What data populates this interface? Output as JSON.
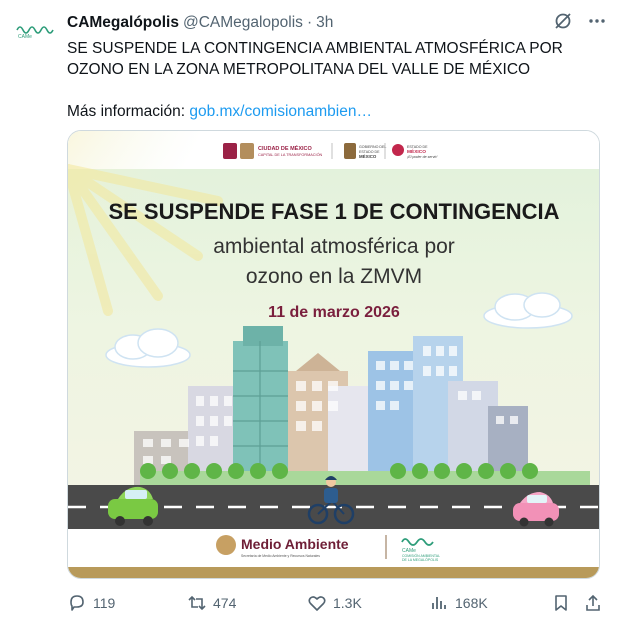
{
  "tweet": {
    "author_name": "CAMegalópolis",
    "author_handle": "@CAMegalopolis",
    "separator": "·",
    "time": "3h",
    "text_line1": "SE SUSPENDE LA CONTINGENCIA AMBIENTAL ATMOSFÉRICA POR",
    "text_line2": "OZONO EN LA ZONA METROPOLITANA DEL VALLE DE MÉXICO",
    "more_label": "Más información:",
    "link_text": "gob.mx/comisionambien…"
  },
  "avatar": {
    "logo_text": "CAMe"
  },
  "card": {
    "title_bold": "SE SUSPENDE FASE 1 DE CONTINGENCIA",
    "subtitle_line1": "ambiental atmosférica por",
    "subtitle_line2": "ozono en la ZMVM",
    "date": "11 de marzo 2026",
    "logos": {
      "cdmx_title": "CIUDAD DE MÉXICO",
      "cdmx_sub": "CAPITAL DE LA TRANSFORMACIÓN",
      "edomex_gov_1": "GOBIERNO DEL",
      "edomex_gov_2": "ESTADO DE",
      "edomex_gov_3": "MÉXICO",
      "edomex_brand_1": "ESTADO DE",
      "edomex_brand_2": "MÉXICO",
      "edomex_brand_3": "¡El poder de servir!"
    },
    "footer": {
      "medio_ambiente": "Medio Ambiente",
      "medio_ambiente_sub": "Secretaría de Medio Ambiente y Recursos Naturales",
      "came_logo": "CAMe",
      "came_sub1": "COMISIÓN AMBIENTAL",
      "came_sub2": "DE LA MEGALÓPOLIS"
    }
  },
  "actions": {
    "replies": "119",
    "reposts": "474",
    "likes": "1.3K",
    "views": "168K"
  },
  "colors": {
    "link": "#1d9bf0",
    "muted": "#536471",
    "date_color": "#7a1f3d",
    "road": "#4a4a4a",
    "footer_bar": "#b89a5a"
  }
}
